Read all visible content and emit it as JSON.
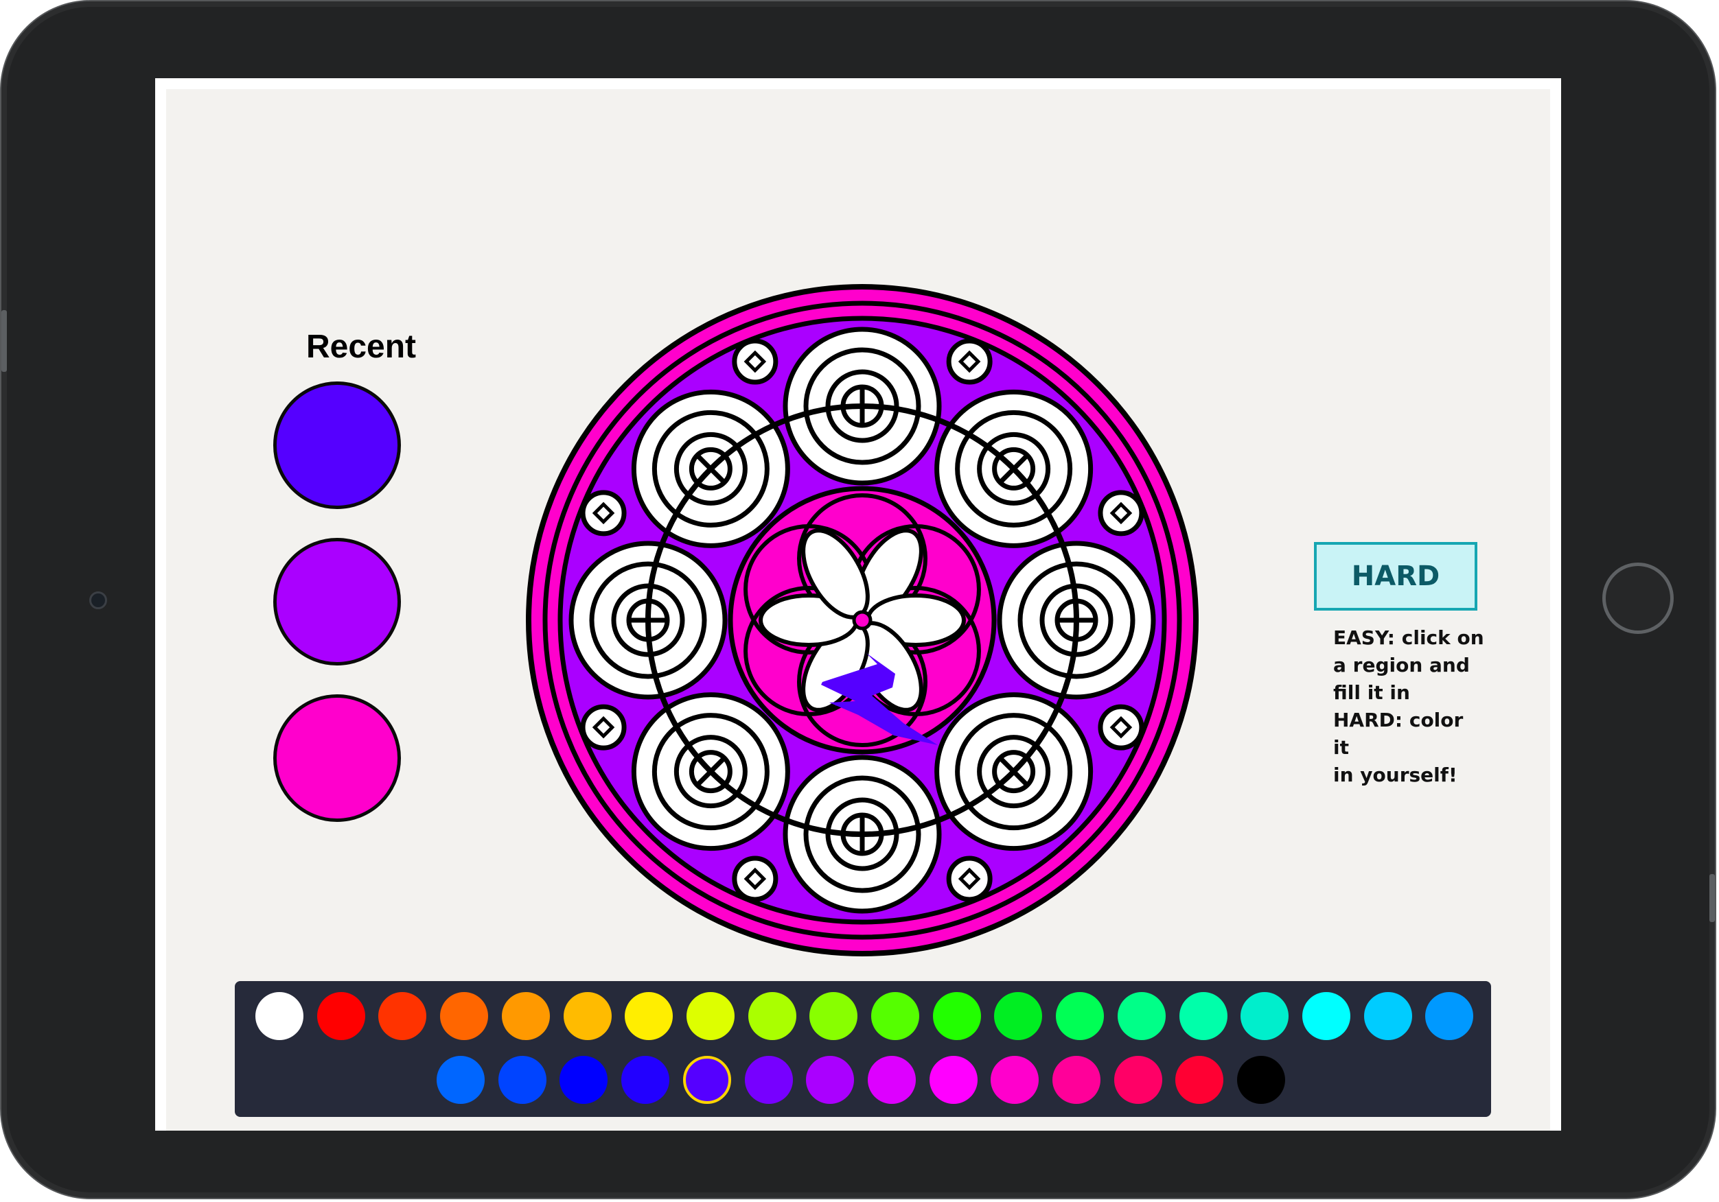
{
  "recent": {
    "title": "Recent",
    "colors": [
      "#5500ff",
      "#aa00ff",
      "#ff00cc"
    ]
  },
  "mode_button": {
    "label": "HARD"
  },
  "help": {
    "line1": "EASY: click on",
    "line2": "a region and",
    "line3": "fill it in",
    "line4": "HARD: color it",
    "line5": "in yourself!"
  },
  "mandala_colors": {
    "ring_outer": "#ff00cc",
    "ring_inner": "#aa00ff",
    "inner_disc": "#ff00cc",
    "stroke": "#000000",
    "fill": "#ffffff",
    "scribble": "#5500ff"
  },
  "palette": {
    "row1": [
      "#ffffff",
      "#ff0000",
      "#ff3300",
      "#ff6600",
      "#ff9900",
      "#ffbb00",
      "#ffee00",
      "#ddff00",
      "#aaff00",
      "#88ff00",
      "#55ff00",
      "#22ff00",
      "#00ee22",
      "#00ff55",
      "#00ff88",
      "#00ffaa",
      "#00eecc",
      "#00ffff",
      "#00ccff",
      "#0099ff"
    ],
    "row2": [
      "#0066ff",
      "#0044ff",
      "#0000ff",
      "#2200ff",
      "#5500ff",
      "#7700ff",
      "#aa00ff",
      "#dd00ff",
      "#ff00ff",
      "#ff00cc",
      "#ff0099",
      "#ff0066",
      "#ff0033",
      "#000000"
    ],
    "selected_color": "#5500ff"
  }
}
